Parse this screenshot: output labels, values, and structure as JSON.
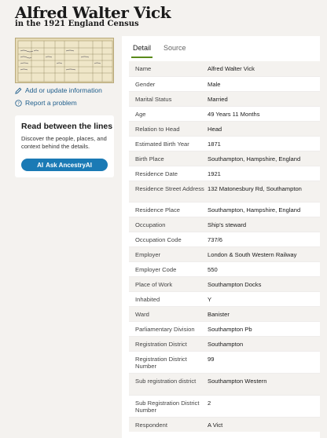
{
  "header": {
    "title": "Alfred Walter Vick",
    "subtitle": "in the 1921 England Census"
  },
  "sidebar": {
    "update_link": "Add or update information",
    "report_link": "Report a problem",
    "card": {
      "title": "Read between the lines",
      "text": "Discover the people, places, and context behind the details.",
      "button": "Ask AncestryAI",
      "button_icon": "AI"
    }
  },
  "tabs": [
    {
      "label": "Detail",
      "active": true
    },
    {
      "label": "Source",
      "active": false
    }
  ],
  "details": [
    {
      "label": "Name",
      "value": "Alfred Walter Vick"
    },
    {
      "label": "Gender",
      "value": "Male"
    },
    {
      "label": "Marital Status",
      "value": "Married"
    },
    {
      "label": "Age",
      "value": "49 Years 11 Months"
    },
    {
      "label": "Relation to Head",
      "value": "Head"
    },
    {
      "label": "Estimated Birth Year",
      "value": "1871"
    },
    {
      "label": "Birth Place",
      "value": "Southampton, Hampshire, England"
    },
    {
      "label": "Residence Date",
      "value": "1921"
    },
    {
      "label": "Residence Street Address",
      "value": "132 Matonesbury Rd, Southampton"
    },
    {
      "label": "Residence Place",
      "value": "Southampton, Hampshire, England"
    },
    {
      "label": "Occupation",
      "value": "Ship's steward"
    },
    {
      "label": "Occupation Code",
      "value": "737/6"
    },
    {
      "label": "Employer",
      "value": "London & South Western Railway"
    },
    {
      "label": "Employer Code",
      "value": "550"
    },
    {
      "label": "Place of Work",
      "value": "Southampton Docks"
    },
    {
      "label": "Inhabited",
      "value": "Y"
    },
    {
      "label": "Ward",
      "value": "Banister"
    },
    {
      "label": "Parliamentary Division",
      "value": "Southampton Pb"
    },
    {
      "label": "Registration District",
      "value": "Southampton"
    },
    {
      "label": "Registration District Number",
      "value": "99"
    },
    {
      "label": "Sub registration district",
      "value": "Southampton Western"
    },
    {
      "label": "Sub Registration District Number",
      "value": "2"
    },
    {
      "label": "Respondent",
      "value": "A Vict"
    }
  ],
  "colors": {
    "accent": "#1a7ab5",
    "link": "#1f5e8c",
    "tab_underline": "#5a8a1a",
    "background": "#f4f2ef"
  }
}
